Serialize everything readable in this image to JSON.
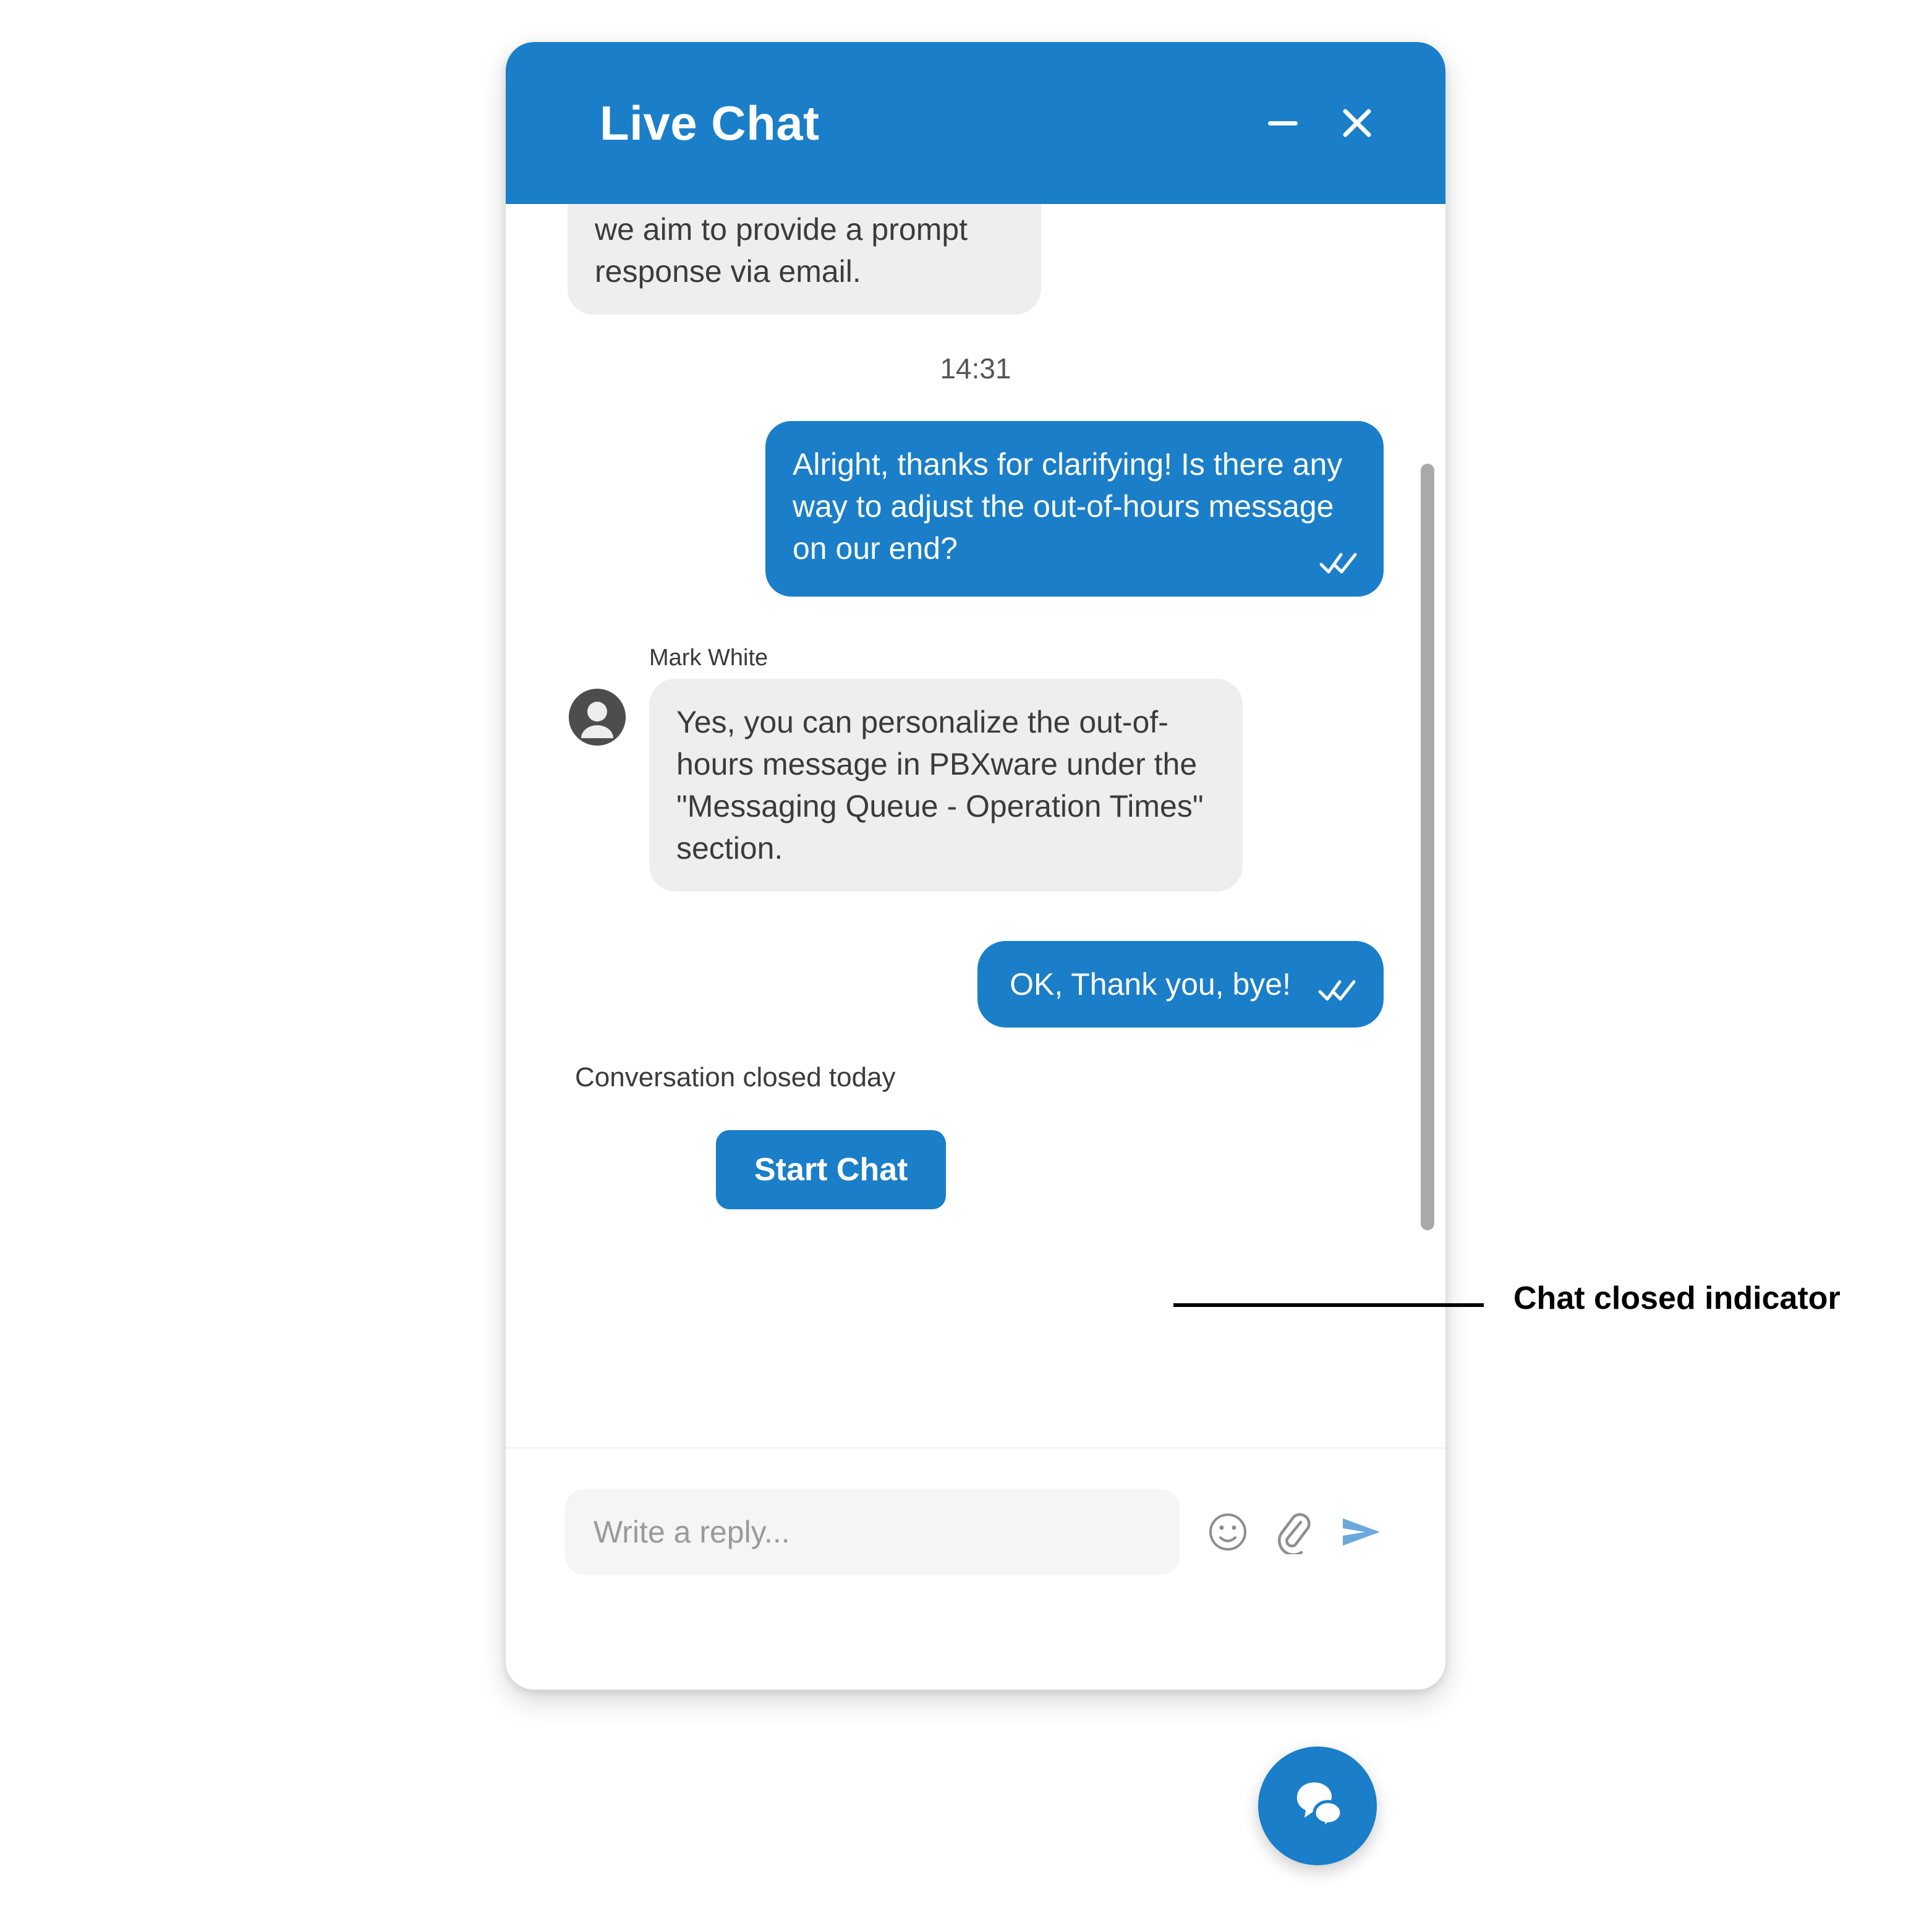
{
  "widget": {
    "header": {
      "title": "Live Chat",
      "minimize_label": "Minimize",
      "close_label": "Close",
      "background_color": "#1a7ec8"
    },
    "messages": [
      {
        "id": "m1",
        "direction": "in",
        "clipped_top": true,
        "text": "using email as an alternative\ncontact method. Rest assured,\nwe aim to provide a prompt\nresponse via email."
      },
      {
        "id": "t1",
        "direction": "timestamp",
        "text": "14:31"
      },
      {
        "id": "m2",
        "direction": "out",
        "text": "Alright, thanks for clarifying! Is there any way to adjust the out-of-hours message on our end?",
        "status": "read"
      },
      {
        "id": "m3",
        "direction": "in",
        "sender": "Mark White",
        "avatar": "person-avatar",
        "text": "Yes, you can personalize the out-of-hours message in PBXware under the \"Messaging Queue - Operation Times\" section."
      },
      {
        "id": "m4",
        "direction": "out",
        "text": "OK, Thank you, bye!",
        "status": "read"
      }
    ],
    "closed_note": "Conversation closed today",
    "start_chat_label": "Start Chat",
    "composer": {
      "placeholder": "Write a reply...",
      "value": "",
      "emoji_label": "Emoji",
      "attach_label": "Attach file",
      "send_label": "Send"
    },
    "scrollbar": {
      "color": "#a9a9a9"
    }
  },
  "launcher": {
    "label": "Open chat",
    "color": "#1a7ec8"
  },
  "annotation": {
    "label": "Chat closed indicator"
  }
}
